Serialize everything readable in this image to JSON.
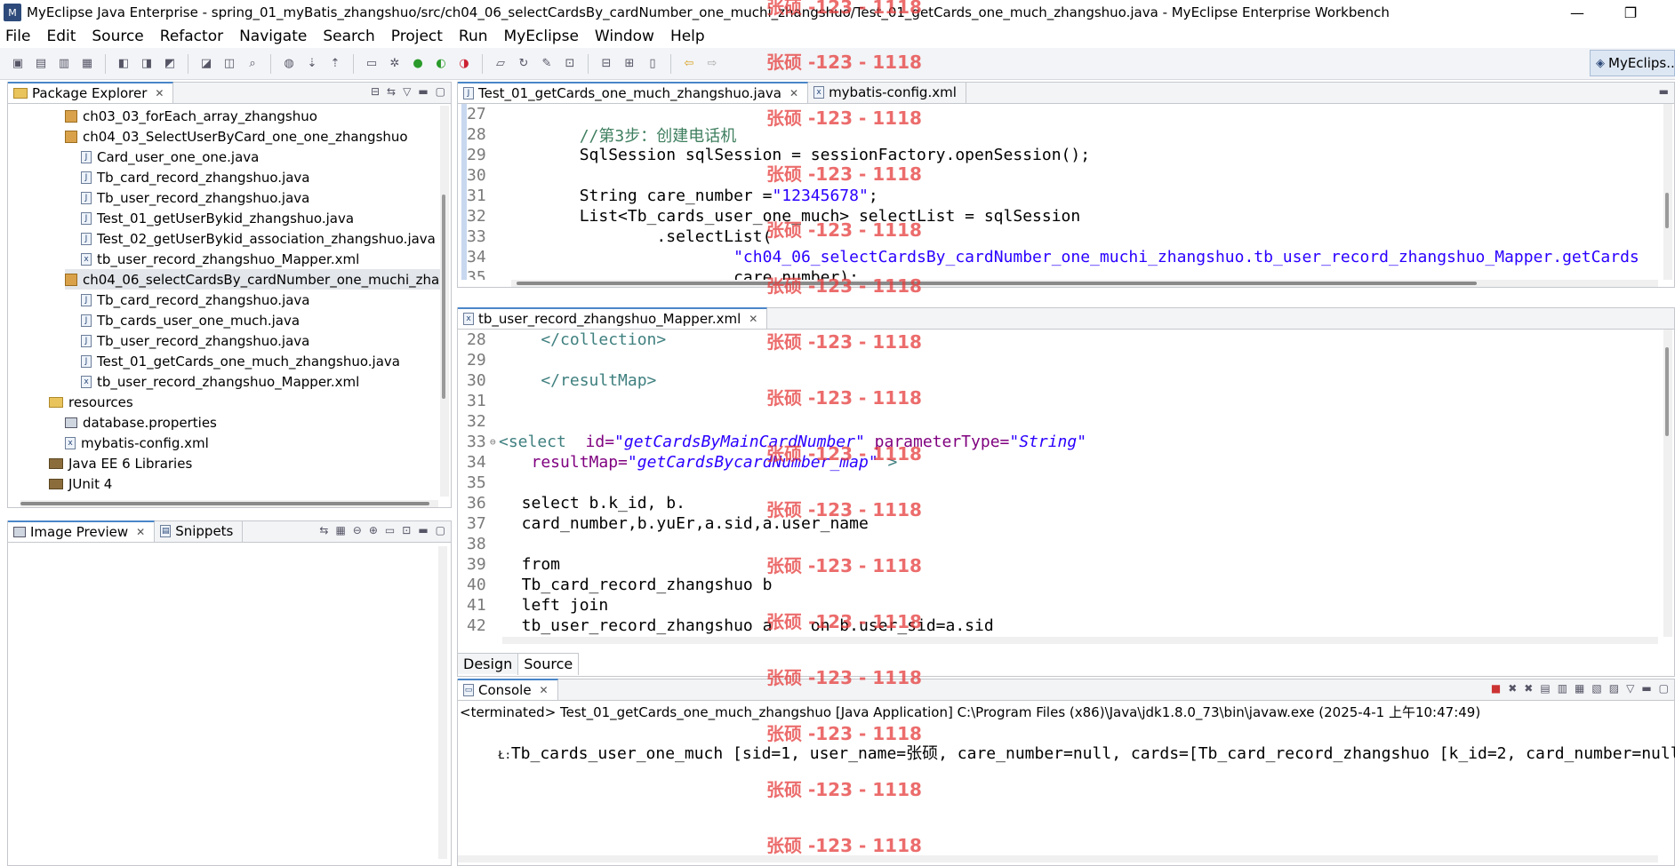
{
  "window": {
    "title": "MyEclipse Java Enterprise - spring_01_myBatis_zhangshuo/src/ch04_06_selectCardsBy_cardNumber_one_muchi_zhangshuo/Test_01_getCards_one_much_zhangshuo.java - MyEclipse Enterprise Workbench",
    "minimize_glyph": "—",
    "restore_glyph": "❐"
  },
  "menu": [
    {
      "label": "File"
    },
    {
      "label": "Edit"
    },
    {
      "label": "Source"
    },
    {
      "label": "Refactor"
    },
    {
      "label": "Navigate"
    },
    {
      "label": "Search"
    },
    {
      "label": "Project"
    },
    {
      "label": "Run"
    },
    {
      "label": "MyEclipse"
    },
    {
      "label": "Window"
    },
    {
      "label": "Help"
    }
  ],
  "perspective": {
    "label": "MyEclips..."
  },
  "package_explorer": {
    "tab_label": "Package Explorer",
    "items": [
      {
        "label": "ch03_03_forEach_array_zhangshuo",
        "icon": "package-icon"
      },
      {
        "label": "ch04_03_SelectUserByCard_one_one_zhangshuo",
        "icon": "package-icon"
      },
      {
        "label": "Card_user_one_one.java",
        "icon": "java-file-icon"
      },
      {
        "label": "Tb_card_record_zhangshuo.java",
        "icon": "java-file-icon"
      },
      {
        "label": "Tb_user_record_zhangshuo.java",
        "icon": "java-file-icon"
      },
      {
        "label": "Test_01_getUserBykid_zhangshuo.java",
        "icon": "java-file-icon"
      },
      {
        "label": "Test_02_getUserBykid_association_zhangshuo.java",
        "icon": "java-file-icon"
      },
      {
        "label": "tb_user_record_zhangshuo_Mapper.xml",
        "icon": "xml-file-icon"
      },
      {
        "label": "ch04_06_selectCardsBy_cardNumber_one_muchi_zhanç",
        "icon": "package-icon"
      },
      {
        "label": "Tb_card_record_zhangshuo.java",
        "icon": "java-file-icon"
      },
      {
        "label": "Tb_cards_user_one_much.java",
        "icon": "java-file-icon"
      },
      {
        "label": "Tb_user_record_zhangshuo.java",
        "icon": "java-file-icon"
      },
      {
        "label": "Test_01_getCards_one_much_zhangshuo.java",
        "icon": "java-file-icon"
      },
      {
        "label": "tb_user_record_zhangshuo_Mapper.xml",
        "icon": "xml-file-icon"
      },
      {
        "label": "resources",
        "icon": "folder-icon"
      },
      {
        "label": "database.properties",
        "icon": "properties-file-icon"
      },
      {
        "label": "mybatis-config.xml",
        "icon": "xml-file-icon"
      },
      {
        "label": "Java EE 6 Libraries",
        "icon": "library-icon"
      },
      {
        "label": "JUnit 4",
        "icon": "library-icon"
      }
    ]
  },
  "image_preview": {
    "tab_label": "Image Preview",
    "snippets_label": "Snippets"
  },
  "java_editor": {
    "tabs": [
      {
        "label": "Test_01_getCards_one_much_zhangshuo.java"
      },
      {
        "label": "mybatis-config.xml"
      }
    ],
    "lines": [
      {
        "no": "27",
        "text": ""
      },
      {
        "no": "28",
        "text": "        //第3步：创建电话机"
      },
      {
        "no": "29",
        "text": "        SqlSession sqlSession = sessionFactory.openSession();"
      },
      {
        "no": "30",
        "text": ""
      },
      {
        "no": "31",
        "text": "        String care_number =",
        "str": "\"12345678\"",
        "tail": ";"
      },
      {
        "no": "32",
        "text": "        List<Tb_cards_user_one_much> selectList = sqlSession"
      },
      {
        "no": "33",
        "text": "                .selectList("
      },
      {
        "no": "34",
        "text": "                        ",
        "str": "\"ch04_06_selectCardsBy_cardNumber_one_muchi_zhangshuo.tb_user_record_zhangshuo_Mapper.getCards"
      },
      {
        "no": "35",
        "text": "                        care_number);"
      }
    ]
  },
  "xml_editor": {
    "tab_label": "tb_user_record_zhangshuo_Mapper.xml",
    "lines": [
      {
        "no": "28",
        "text": "    </collection>"
      },
      {
        "no": "29",
        "text": ""
      },
      {
        "no": "30",
        "text": "    </resultMap>"
      },
      {
        "no": "31",
        "text": ""
      },
      {
        "no": "32",
        "text": ""
      },
      {
        "no": "33",
        "marker": "⊖",
        "p1": "<select",
        "p2": "  id=",
        "p3": "\"getCardsByMainCardNumber\"",
        "p4": " parameterType=",
        "p5": "\"String\""
      },
      {
        "no": "34",
        "p2": "   resultMap=",
        "p3": "\"getCardsBycardNumber_map\"",
        "p6": " >"
      },
      {
        "no": "35",
        "text": ""
      },
      {
        "no": "36",
        "text": "  select b.k_id, b."
      },
      {
        "no": "37",
        "text": "  card_number,b.yuEr,a.sid,a.user_name"
      },
      {
        "no": "38",
        "text": ""
      },
      {
        "no": "39",
        "text": "  from"
      },
      {
        "no": "40",
        "text": "  Tb_card_record_zhangshuo b"
      },
      {
        "no": "41",
        "text": "  left join"
      },
      {
        "no": "42",
        "text": "  tb_user_record_zhangshuo a    on b.user_sid=a.sid"
      }
    ],
    "bottom_tabs": [
      {
        "label": "Design"
      },
      {
        "label": "Source"
      }
    ]
  },
  "console": {
    "tab_label": "Console",
    "status": "<terminated> Test_01_getCards_one_much_zhangshuo [Java Application] C:\\Program Files (x86)\\Java\\jdk1.8.0_73\\bin\\javaw.exe (2025-4-1 上午10:47:49)",
    "output": "Tb_cards_user_one_much [sid=1, user_name=张硕, care_number=null, cards=[Tb_card_record_zhangshuo [k_id=2, card_number=null",
    "output_prefix": "Ł:"
  },
  "watermark": {
    "text": "张硕 -123 - 1118",
    "color": "#e63c3c"
  }
}
